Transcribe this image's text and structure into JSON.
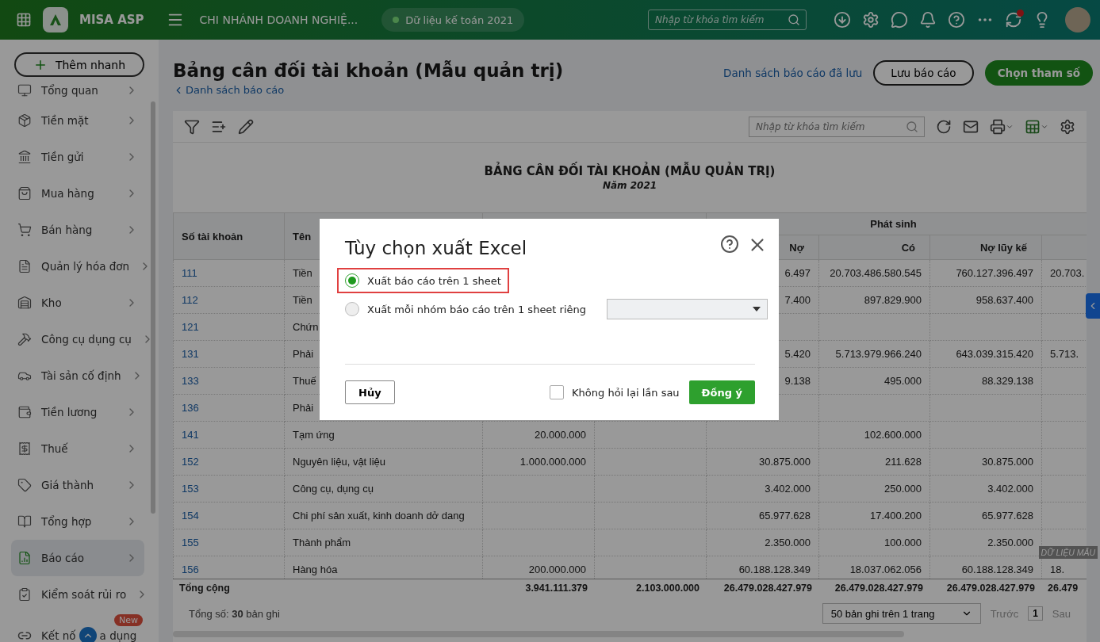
{
  "topbar": {
    "brand": "MISA ASP",
    "branch": "CHI NHÁNH DOANH NGHIỆ...",
    "dataset": "Dữ liệu kế toán 2021",
    "search": {
      "placeholder": "Nhập từ khóa tìm kiếm"
    },
    "sync_alert": true
  },
  "sidebar": {
    "quick_add": "Thêm nhanh",
    "items": [
      {
        "label": "Tổng quan",
        "selected": false
      },
      {
        "label": "Tiền mặt",
        "selected": false
      },
      {
        "label": "Tiền gửi",
        "selected": false
      },
      {
        "label": "Mua hàng",
        "selected": false
      },
      {
        "label": "Bán hàng",
        "selected": false
      },
      {
        "label": "Quản lý hóa đơn",
        "selected": false
      },
      {
        "label": "Kho",
        "selected": false
      },
      {
        "label": "Công cụ dụng cụ",
        "selected": false
      },
      {
        "label": "Tài sản cố định",
        "selected": false
      },
      {
        "label": "Tiền lương",
        "selected": false
      },
      {
        "label": "Thuế",
        "selected": false
      },
      {
        "label": "Giá thành",
        "selected": false
      },
      {
        "label": "Tổng hợp",
        "selected": false
      },
      {
        "label": "Báo cáo",
        "selected": true
      },
      {
        "label": "Kiểm soát rủi ro",
        "selected": false
      }
    ],
    "last_item": {
      "label": "Kết nố",
      "label_tail": "a dụng",
      "badge": "New"
    }
  },
  "page": {
    "title": "Bảng cân đối tài khoản (Mẫu quản trị)",
    "back_link": "Danh sách báo cáo",
    "saved_link": "Danh sách báo cáo đã lưu",
    "save_button": "Lưu báo cáo",
    "params_button": "Chọn tham số",
    "search": {
      "placeholder": "Nhập từ khóa tìm kiếm"
    }
  },
  "report": {
    "title": "BẢNG CÂN ĐỐI TÀI KHOẢN (MẪU QUẢN TRỊ)",
    "subtitle": "Năm 2021",
    "stamp": "DỮ LIỆU MẪU",
    "headers": {
      "account": "Số tài khoản",
      "name": "Tên",
      "group": "Phát sinh",
      "sub": [
        "Nợ",
        "Có",
        "Nợ lũy kế"
      ]
    },
    "rows": [
      {
        "account": "111",
        "name": "Tiền",
        "column_5": "6.497",
        "column_6": "20.703.486.580.545",
        "column_7": "760.127.396.497",
        "column_8": "20.703."
      },
      {
        "account": "112",
        "name": "Tiền",
        "column_5": "7.400",
        "column_6": "897.829.900",
        "column_7": "958.637.400"
      },
      {
        "account": "121",
        "name": "Chứn"
      },
      {
        "account": "131",
        "name": "Phải",
        "column_5": "5.420",
        "column_6": "5.713.979.966.240",
        "column_7": "643.039.315.420",
        "column_8": "5.713."
      },
      {
        "account": "133",
        "name": "Thuế",
        "column_5": "9.138",
        "column_6": "495.000",
        "column_7": "88.329.138"
      },
      {
        "account": "136",
        "name": "Phải"
      },
      {
        "account": "141",
        "name": "Tạm ứng",
        "column_3": "20.000.000",
        "column_6": "102.600.000"
      },
      {
        "account": "152",
        "name": "Nguyên liệu, vật liệu",
        "column_3": "1.000.000.000",
        "column_5": "30.875.000",
        "column_6": "211.628",
        "column_7": "30.875.000"
      },
      {
        "account": "153",
        "name": "Công cụ, dụng cụ",
        "column_5": "3.402.000",
        "column_6": "250.000",
        "column_7": "3.402.000"
      },
      {
        "account": "154",
        "name": "Chi phí sản xuất, kinh doanh dở dang",
        "column_5": "65.977.628",
        "column_6": "17.400.200",
        "column_7": "65.977.628"
      },
      {
        "account": "155",
        "name": "Thành phẩm",
        "column_5": "2.350.000",
        "column_6": "100.000",
        "column_7": "2.350.000"
      },
      {
        "account": "156",
        "name": "Hàng hóa",
        "column_3": "200.000.000",
        "column_5": "60.188.128.349",
        "column_6": "18.037.062.056",
        "column_7": "60.188.128.349",
        "column_8": "18."
      }
    ],
    "totals": {
      "label": "Tổng cộng",
      "column_3": "3.941.111.379",
      "column_4": "2.103.000.000",
      "column_5": "26.479.028.427.979",
      "column_6": "26.479.028.427.979",
      "column_7": "26.479.028.427.979",
      "column_8": "26.479"
    },
    "record_count": "Tổng số: **30** bản ghi",
    "page_size": "50 bản ghi trên 1 trang",
    "prev": "Trước",
    "page": "1",
    "next": "Sau"
  },
  "dialog": {
    "title": "Tùy chọn xuất Excel",
    "options": [
      {
        "label": "Xuất báo cáo trên 1 sheet",
        "selected": true,
        "highlighted": true,
        "kind": "plain"
      },
      {
        "label": "Xuất mỗi nhóm báo cáo trên 1 sheet riêng",
        "selected": false,
        "highlighted": false,
        "kind": "select"
      }
    ],
    "cancel": "Hủy",
    "dont_ask": {
      "label": "Không hỏi lại lần sau",
      "checked": false
    },
    "confirm": "Đồng ý"
  }
}
